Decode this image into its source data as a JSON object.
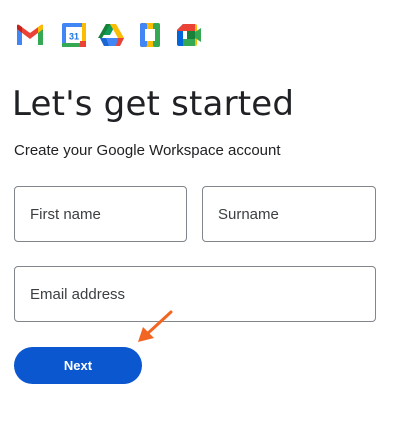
{
  "header": {
    "logos": [
      {
        "icon": "gmail-icon"
      },
      {
        "icon": "calendar-icon",
        "text": "31"
      },
      {
        "icon": "drive-icon"
      },
      {
        "icon": "docs-icon"
      },
      {
        "icon": "meet-icon"
      }
    ]
  },
  "main": {
    "title": "Let's get started",
    "subtitle": "Create your Google Workspace account",
    "fields": {
      "first_name": {
        "placeholder": "First name",
        "value": ""
      },
      "surname": {
        "placeholder": "Surname",
        "value": ""
      },
      "email": {
        "placeholder": "Email address",
        "value": ""
      }
    },
    "next_label": "Next"
  },
  "colors": {
    "primary_button": "#0b57d0",
    "annotation_arrow": "#f26522",
    "text": "#202124",
    "field_border": "#80868b"
  }
}
